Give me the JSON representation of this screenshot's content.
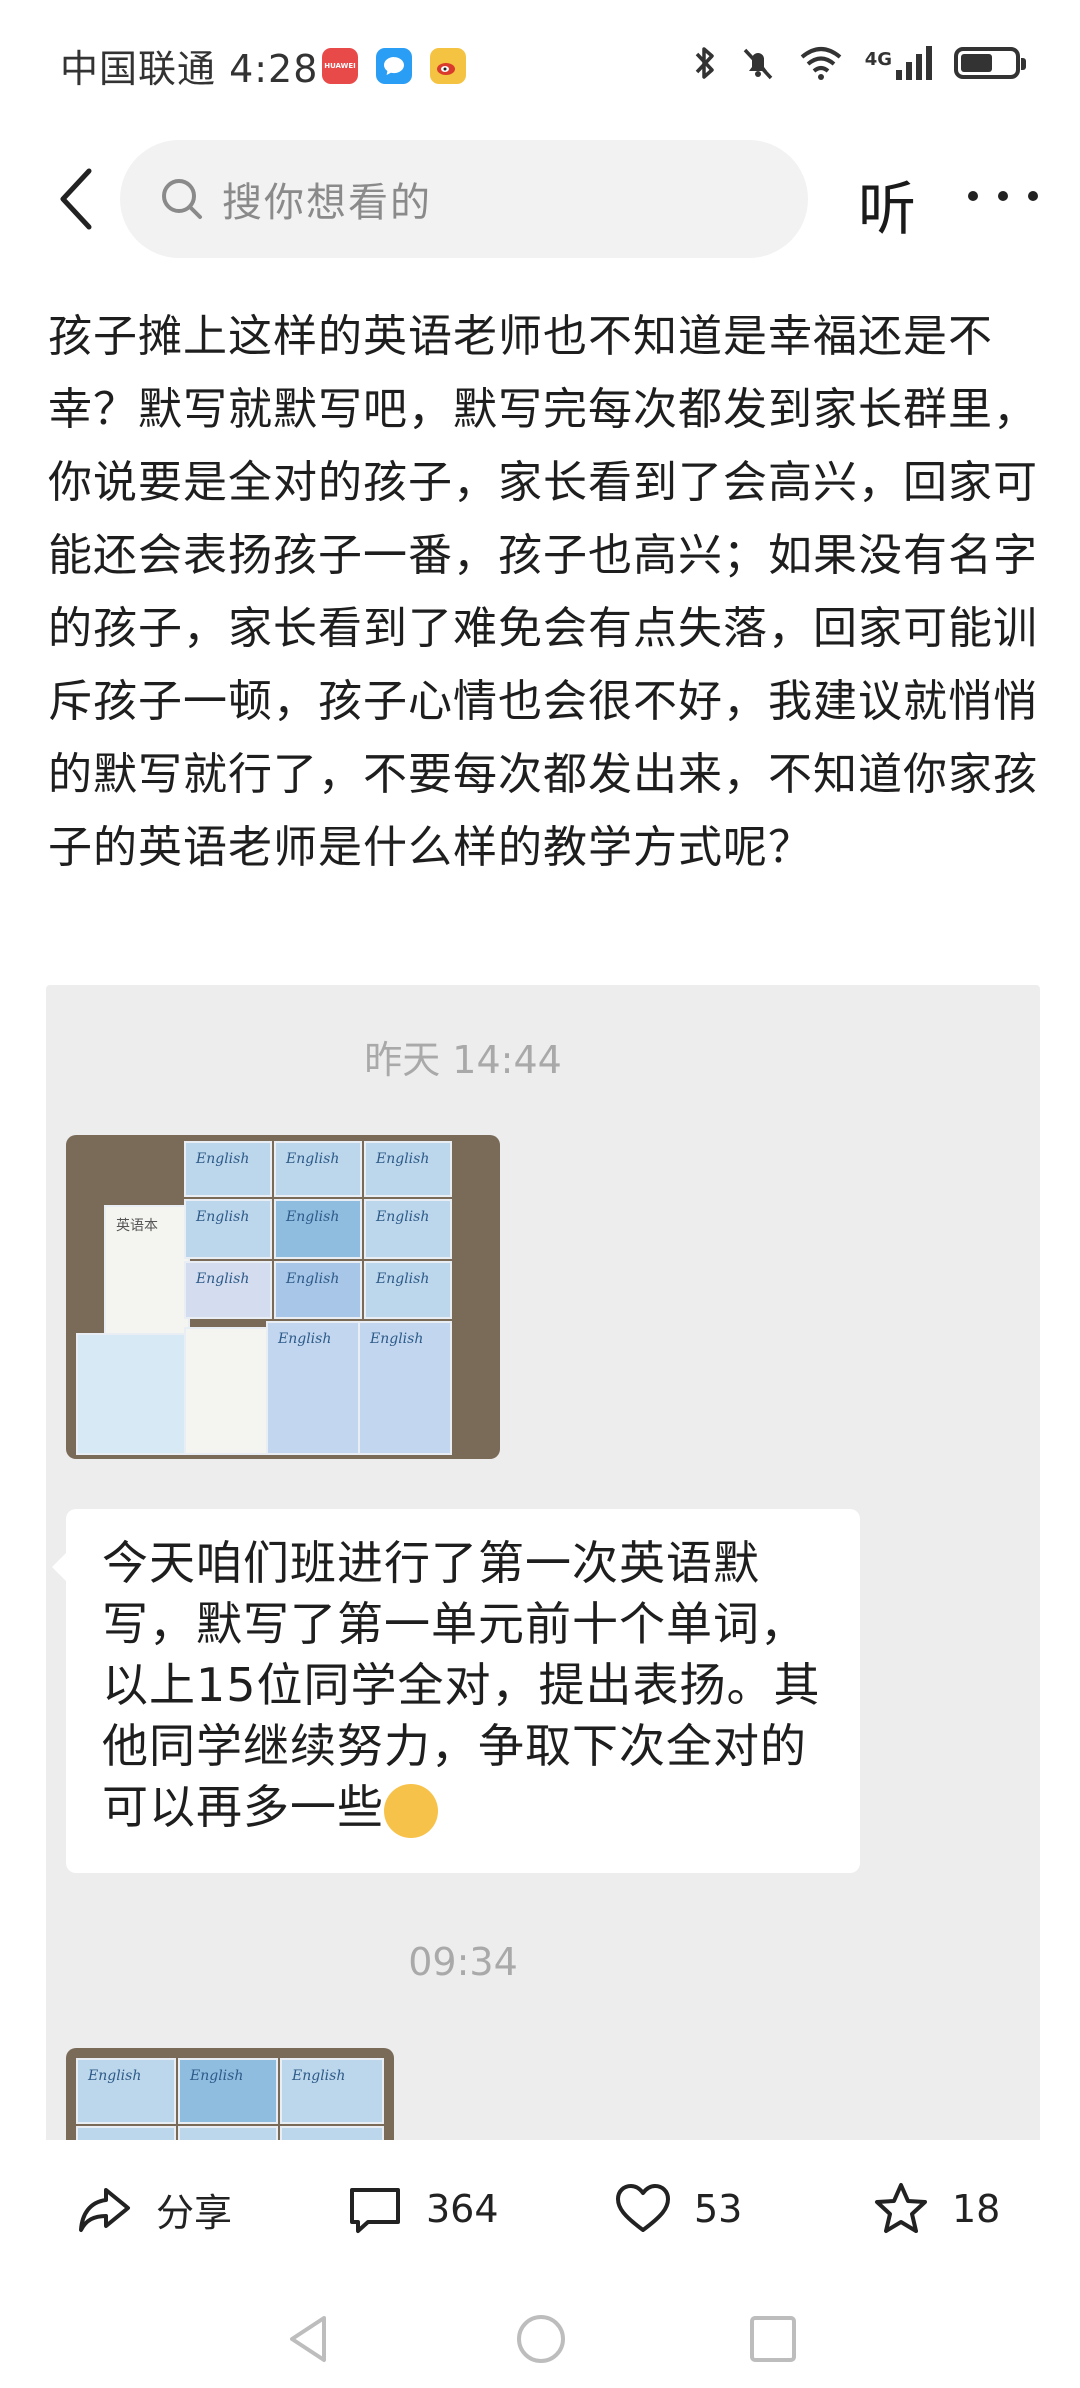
{
  "status_bar": {
    "carrier_time": "中国联通 4:28",
    "network": "4G",
    "huawei_label": "HUAWEI",
    "battery_level": 0.6
  },
  "header": {
    "search_placeholder": "搜你想看的",
    "listen_label": "听"
  },
  "article": {
    "text": "孩子摊上这样的英语老师也不知道是幸福还是不幸？默写就默写吧，默写完每次都发到家长群里，你说要是全对的孩子，家长看到了会高兴，回家可能还会表扬孩子一番，孩子也高兴；如果没有名字的孩子，家长看到了难免会有点失落，回家可能训斥孩子一顿，孩子心情也会很不好，我建议就悄悄的默写就行了，不要每次都发出来，不知道你家孩子的英语老师是什么样的教学方式呢？"
  },
  "screenshot": {
    "timestamp_1": "昨天 14:44",
    "message": "今天咱们班进行了第一次英语默写，默写了第一单元前十个单词，以上15位同学全对，提出表扬。其他同学继续努力，争取下次全对的可以再多一些",
    "timestamp_2": "09:34",
    "book_title": "English",
    "notebook_title": "英语本"
  },
  "actions": {
    "share_label": "分享",
    "comments": "364",
    "likes": "53",
    "favorites": "18"
  }
}
